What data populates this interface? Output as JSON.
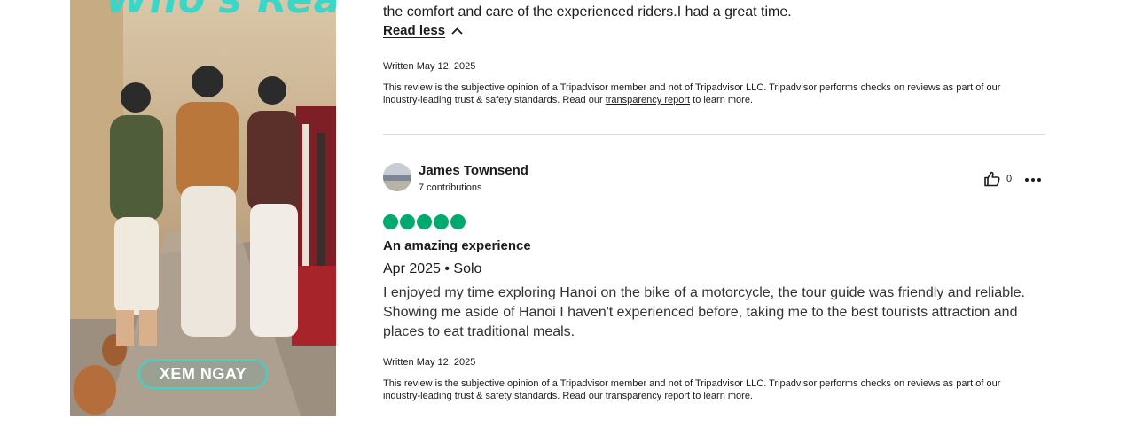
{
  "ad": {
    "headline": "Who's Ready?",
    "cta_label": "XEM NGAY"
  },
  "previous_review": {
    "body_tail": "the comfort and care of the experienced riders.I had a great time.",
    "read_less_label": "Read less",
    "written": "Written May 12, 2025",
    "disclaimer_before": "This review is the subjective opinion of a Tripadvisor member and not of Tripadvisor LLC. Tripadvisor performs checks on reviews as part of our industry-leading trust & safety standards. Read our ",
    "disclaimer_link": "transparency report",
    "disclaimer_after": " to learn more."
  },
  "review": {
    "author": "James Townsend",
    "contributions": "7 contributions",
    "helpful_count": "0",
    "rating": 5,
    "rating_max": 5,
    "title": "An amazing experience",
    "date_trip": "Apr 2025 • Solo",
    "body": "I enjoyed my time exploring Hanoi on the bike of a motorcycle, the tour guide was friendly and reliable. Showing me aside of Hanoi I haven't experienced before, taking me to the best tourists attraction and places to eat traditional meals.",
    "written": "Written May 12, 2025",
    "disclaimer_before": "This review is the subjective opinion of a Tripadvisor member and not of Tripadvisor LLC. Tripadvisor performs checks on reviews as part of our industry-leading trust & safety standards. Read our ",
    "disclaimer_link": "transparency report",
    "disclaimer_after": " to learn more."
  },
  "colors": {
    "bubble": "#00aa6c",
    "accent_teal": "#3ad6c7"
  }
}
